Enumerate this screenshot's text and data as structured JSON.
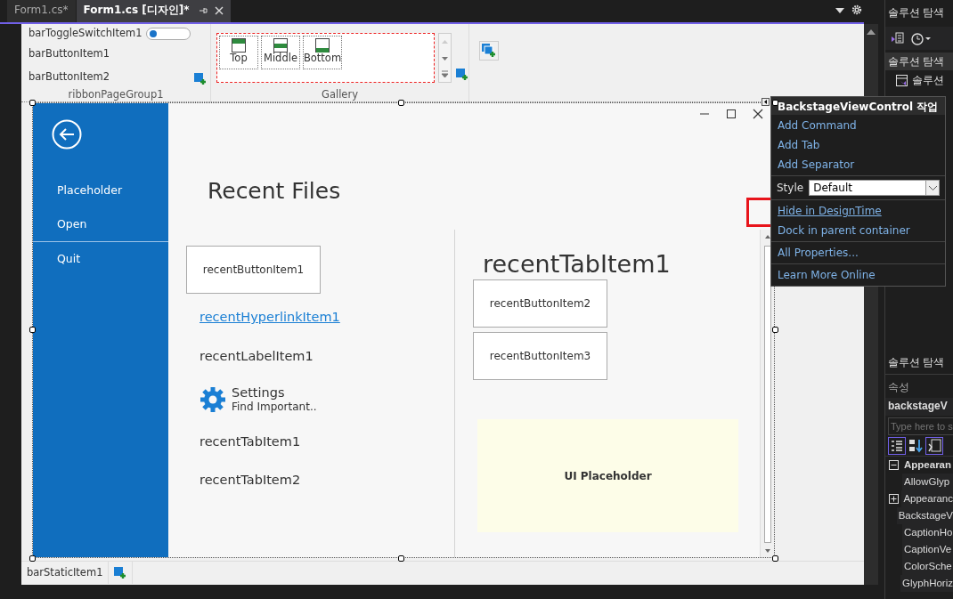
{
  "document_tabs": [
    {
      "label": "Form1.cs*",
      "selected": false
    },
    {
      "label": "Form1.cs [디자인]*",
      "selected": true
    }
  ],
  "ribbon": {
    "groups": [
      {
        "caption": "ribbonPageGroup1",
        "items": [
          {
            "kind": "toggle",
            "label": "barToggleSwitchItem1",
            "on": false
          },
          {
            "kind": "button",
            "label": "barButtonItem1"
          },
          {
            "kind": "button",
            "label": "barButtonItem2"
          }
        ]
      },
      {
        "caption": "Gallery",
        "items": [
          {
            "kind": "top",
            "label": "Top"
          },
          {
            "kind": "middle",
            "label": "Middle"
          },
          {
            "kind": "bottom",
            "label": "Bottom"
          }
        ]
      },
      {
        "kind": "add_only"
      }
    ]
  },
  "backstage": {
    "nav": [
      {
        "kind": "item",
        "label": "Placeholder"
      },
      {
        "kind": "item",
        "label": "Open"
      },
      {
        "kind": "separator"
      },
      {
        "kind": "item",
        "label": "Quit"
      }
    ],
    "title": "Recent Files",
    "left_items": [
      {
        "kind": "button",
        "label": "recentButtonItem1"
      },
      {
        "kind": "hyperlink",
        "label": "recentHyperlinkItem1"
      },
      {
        "kind": "label",
        "label": "recentLabelItem1"
      },
      {
        "kind": "command",
        "label": "Settings",
        "description": "Find Important.."
      },
      {
        "kind": "tab",
        "label": "recentTabItem1"
      },
      {
        "kind": "tab",
        "label": "recentTabItem2"
      }
    ],
    "right_panel": {
      "title": "recentTabItem1",
      "buttons": [
        "recentButtonItem2",
        "recentButtonItem3"
      ],
      "placeholder_label": "UI Placeholder"
    }
  },
  "status_bar": {
    "items": [
      "barStaticItem1"
    ]
  },
  "smart_tag": {
    "title": "BackstageViewControl 작업",
    "sections": [
      [
        {
          "kind": "link",
          "label": "Add Command",
          "hovered": false
        },
        {
          "kind": "link",
          "label": "Add Tab",
          "hovered": false
        },
        {
          "kind": "link",
          "label": "Add Separator",
          "hovered": false
        }
      ],
      [
        {
          "kind": "combo",
          "label": "Style",
          "value": "Default"
        }
      ],
      [
        {
          "kind": "link",
          "label": "Hide in DesignTime",
          "hovered": true
        },
        {
          "kind": "link",
          "label": "Dock in parent container",
          "hovered": false
        }
      ],
      [
        {
          "kind": "link",
          "label": "All Properties...",
          "hovered": false
        }
      ],
      [
        {
          "kind": "link",
          "label": "Learn More Online",
          "hovered": false
        }
      ]
    ]
  },
  "solution_explorer": {
    "title": "솔루션 탐색",
    "search_label": "솔루션 탐색",
    "tree": [
      {
        "label": "솔루션"
      }
    ],
    "tab_label": "솔루션 탐색"
  },
  "properties": {
    "title": "속성",
    "object": "backstageV",
    "search_placeholder": "Type here to s",
    "rows": [
      {
        "kind": "category",
        "label": "Appearan",
        "expanded": true
      },
      {
        "kind": "property",
        "label": "AllowGlyp"
      },
      {
        "kind": "property",
        "label": "Appearanc",
        "expanded": false
      },
      {
        "kind": "property",
        "label": "BackstageV"
      },
      {
        "kind": "property",
        "label": "CaptionHo"
      },
      {
        "kind": "property",
        "label": "CaptionVe"
      },
      {
        "kind": "property",
        "label": "ColorSche"
      },
      {
        "kind": "property",
        "label": "GlyphHoriz"
      }
    ]
  }
}
